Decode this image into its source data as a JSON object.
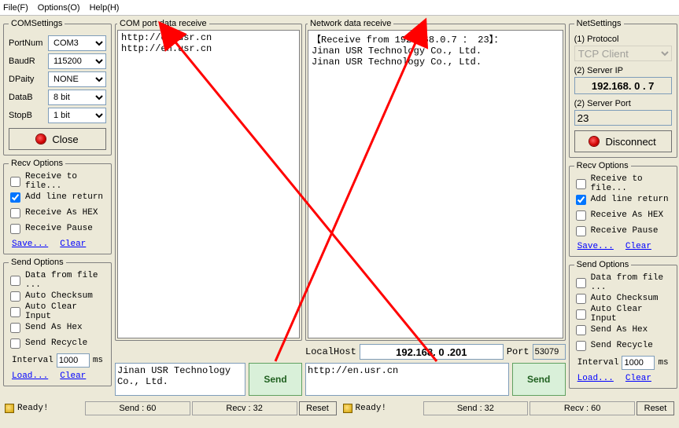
{
  "menu": {
    "file": "File(F)",
    "options": "Options(O)",
    "help": "Help(H)"
  },
  "com_settings": {
    "legend": "COMSettings",
    "portnum_label": "PortNum",
    "portnum_value": "COM3",
    "baudr_label": "BaudR",
    "baudr_value": "115200",
    "dparity_label": "DPaity",
    "dparity_value": "NONE",
    "datab_label": "DataB",
    "datab_value": "8 bit",
    "stopb_label": "StopB",
    "stopb_value": "1 bit",
    "close_btn": "Close"
  },
  "recv_options_left": {
    "legend": "Recv Options",
    "to_file": "Receive to file...",
    "add_line": "Add line return",
    "as_hex": "Receive As HEX",
    "pause": "Receive Pause",
    "save": "Save...",
    "clear": "Clear"
  },
  "send_options_left": {
    "legend": "Send Options",
    "from_file": "Data from file ...",
    "auto_checksum": "Auto Checksum",
    "auto_clear": "Auto Clear Input",
    "as_hex": "Send As Hex",
    "recycle": "Send Recycle",
    "interval_label": "Interval",
    "interval_value": "1000",
    "interval_unit": "ms",
    "load": "Load...",
    "clear": "Clear"
  },
  "com_panel": {
    "legend": "COM port data receive",
    "content": "http://en.usr.cn\nhttp://en.usr.cn",
    "send_text": "Jinan USR Technology Co., Ltd.",
    "send_btn": "Send",
    "ready": "Ready!",
    "stat_send": "Send : 60",
    "stat_recv": "Recv : 32",
    "reset": "Reset"
  },
  "net_panel": {
    "legend": "Network data receive",
    "content": "【Receive from 192.168.0.7 ： 23】：\nJinan USR Technology Co., Ltd.\nJinan USR Technology Co., Ltd.",
    "localhost_label": "LocalHost",
    "localhost_ip": "192.168. 0 .201",
    "port_label": "Port",
    "port_value": "53079",
    "send_text": "http://en.usr.cn",
    "send_btn": "Send",
    "ready": "Ready!",
    "stat_send": "Send : 32",
    "stat_recv": "Recv : 60",
    "reset": "Reset"
  },
  "net_settings": {
    "legend": "NetSettings",
    "protocol_label": "(1) Protocol",
    "protocol_value": "TCP Client",
    "serverip_label": "(2) Server IP",
    "serverip_value": "192.168. 0 . 7",
    "serverport_label": "(2) Server Port",
    "serverport_value": "23",
    "disconnect_btn": "Disconnect"
  },
  "recv_options_right": {
    "legend": "Recv Options",
    "to_file": "Receive to file...",
    "add_line": "Add line return",
    "as_hex": "Receive As HEX",
    "pause": "Receive Pause",
    "save": "Save...",
    "clear": "Clear"
  },
  "send_options_right": {
    "legend": "Send Options",
    "from_file": "Data from file ...",
    "auto_checksum": "Auto Checksum",
    "auto_clear": "Auto Clear Input",
    "as_hex": "Send As Hex",
    "recycle": "Send Recycle",
    "interval_label": "Interval",
    "interval_value": "1000",
    "interval_unit": "ms",
    "load": "Load...",
    "clear": "Clear"
  }
}
